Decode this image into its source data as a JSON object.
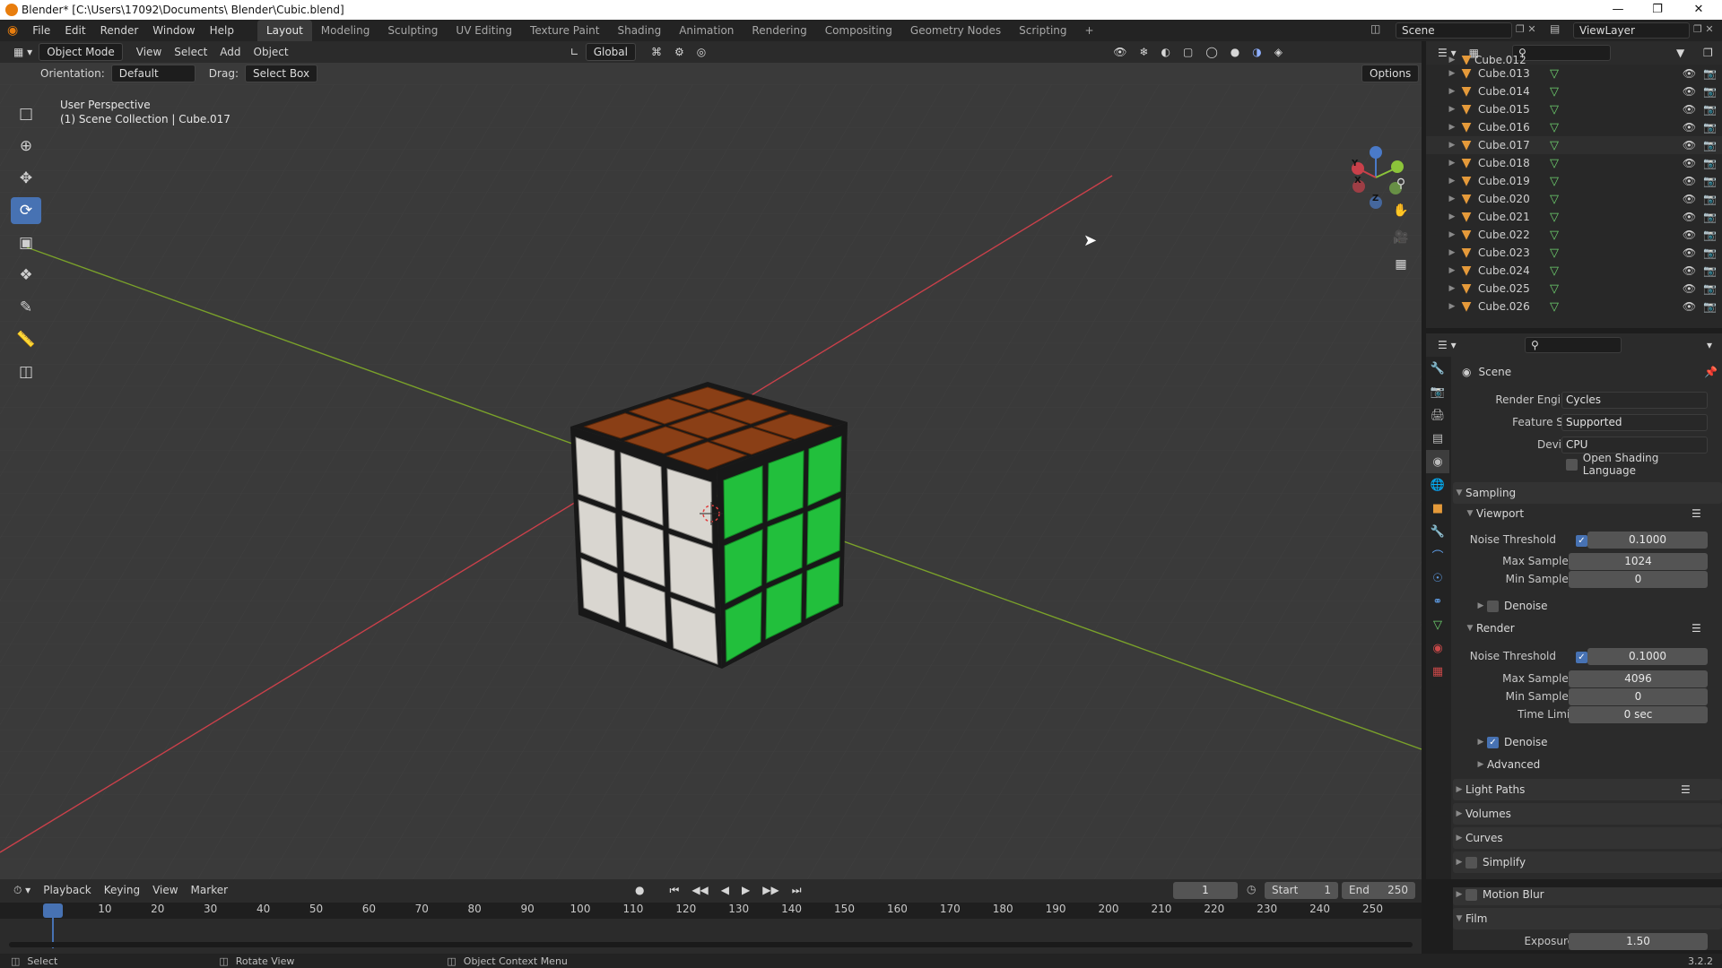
{
  "window": {
    "title": "Blender* [C:\\Users\\17092\\Documents\\ Blender\\Cubic.blend]",
    "version": "3.2.2"
  },
  "menu": [
    "File",
    "Edit",
    "Render",
    "Window",
    "Help"
  ],
  "workspaces": [
    "Layout",
    "Modeling",
    "Sculpting",
    "UV Editing",
    "Texture Paint",
    "Shading",
    "Animation",
    "Rendering",
    "Compositing",
    "Geometry Nodes",
    "Scripting",
    "+"
  ],
  "active_workspace": "Layout",
  "scene_name": "Scene",
  "view_layer": "ViewLayer",
  "viewport": {
    "mode": "Object Mode",
    "menus": [
      "View",
      "Select",
      "Add",
      "Object"
    ],
    "transform_orientation": "Global",
    "orientation_label": "Orientation:",
    "orientation_value": "Default",
    "drag_label": "Drag:",
    "drag_value": "Select Box",
    "options_label": "Options",
    "perspective": "User Perspective",
    "collection_info": "(1) Scene Collection | Cube.017",
    "gizmo": {
      "x": "X",
      "y": "Y",
      "z": "Z"
    }
  },
  "tools": [
    "select-box-icon",
    "cursor-icon",
    "move-icon",
    "rotate-icon",
    "scale-icon",
    "transform-icon",
    "annotate-icon",
    "measure-icon",
    "add-cube-icon"
  ],
  "active_tool": "rotate-icon",
  "colors": {
    "accent": "#4772b3",
    "object_orange": "#e59a3a",
    "mesh_green": "#6fd36f",
    "cube_top": "#8a3f16",
    "cube_front": "#d9d6d0",
    "cube_side": "#22bf3c",
    "axis_x": "#c9404a",
    "axis_y": "#7aa12a"
  },
  "outliner": {
    "items": [
      "Cube.013",
      "Cube.014",
      "Cube.015",
      "Cube.016",
      "Cube.017",
      "Cube.018",
      "Cube.019",
      "Cube.020",
      "Cube.021",
      "Cube.022",
      "Cube.023",
      "Cube.024",
      "Cube.025",
      "Cube.026"
    ],
    "partial_top_item": "Cube.012"
  },
  "properties": {
    "context": "Scene",
    "render_engine_label": "Render Engine",
    "render_engine": "Cycles",
    "feature_set_label": "Feature Set",
    "feature_set": "Supported",
    "device_label": "Device",
    "device": "CPU",
    "osl_label": "Open Shading Language",
    "sampling": "Sampling",
    "viewport_section": "Viewport",
    "render_section": "Render",
    "noise_threshold_label": "Noise Threshold",
    "max_samples_label": "Max Samples",
    "min_samples_label": "Min Samples",
    "time_limit_label": "Time Limit",
    "denoise_label": "Denoise",
    "advanced_label": "Advanced",
    "viewport_noise": "0.1000",
    "viewport_max": "1024",
    "viewport_min": "0",
    "render_noise": "0.1000",
    "render_max": "4096",
    "render_min": "0",
    "time_limit": "0 sec",
    "sections": [
      "Light Paths",
      "Volumes",
      "Curves",
      "Simplify",
      "Motion Blur",
      "Film"
    ],
    "exposure_label": "Exposure",
    "exposure": "1.50"
  },
  "timeline": {
    "menus": [
      "Playback",
      "Keying",
      "View",
      "Marker"
    ],
    "current_frame": "1",
    "start_label": "Start",
    "start": "1",
    "end_label": "End",
    "end": "250",
    "ticks": [
      "1",
      "10",
      "20",
      "30",
      "40",
      "50",
      "60",
      "70",
      "80",
      "90",
      "100",
      "110",
      "120",
      "130",
      "140",
      "150",
      "160",
      "170",
      "180",
      "190",
      "200",
      "210",
      "220",
      "230",
      "240",
      "250"
    ]
  },
  "statusbar": {
    "select": "Select",
    "rotate_view": "Rotate View",
    "context_menu": "Object Context Menu"
  }
}
